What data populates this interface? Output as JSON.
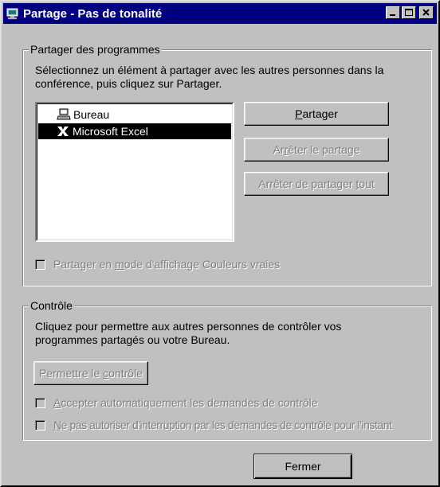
{
  "window": {
    "title": "Partage - Pas de tonalité",
    "icon": "netmeeting-sharing-icon"
  },
  "share_group": {
    "legend": "Partager des programmes",
    "description": "Sélectionnez un élément à partager avec les autres personnes dans la conférence, puis cliquez sur Partager.",
    "items": [
      {
        "label": "Bureau",
        "icon": "desktop-icon",
        "selected": false
      },
      {
        "label": "Microsoft Excel",
        "icon": "excel-icon",
        "selected": true
      }
    ],
    "share_button": {
      "pre": "",
      "mnemonic": "P",
      "post": "artager",
      "enabled": true
    },
    "stop_button": {
      "pre": "Ar",
      "mnemonic": "r",
      "post": "êter le partage",
      "enabled": false
    },
    "stop_all_button": {
      "pre": "Arrêter de partager ",
      "mnemonic": "t",
      "post": "out",
      "enabled": false
    },
    "true_color_checkbox": {
      "pre": "Partager en ",
      "mnemonic": "m",
      "post": "ode d'affichage Couleurs vraies",
      "checked": false,
      "enabled": false
    }
  },
  "control_group": {
    "legend": "Contrôle",
    "description": "Cliquez pour permettre aux autres personnes de contrôler vos programmes partagés ou votre Bureau.",
    "allow_button": {
      "pre": "Permettre le ",
      "mnemonic": "c",
      "post": "ontrôle",
      "enabled": false
    },
    "auto_accept_checkbox": {
      "pre": "",
      "mnemonic": "A",
      "post": "ccepter automatiquement les demandes de contrôle",
      "checked": false,
      "enabled": false
    },
    "no_interrupt_checkbox": {
      "pre": "",
      "mnemonic": "N",
      "post": "e pas autoriser d'interruption par les demandes de contrôle pour l'instant",
      "checked": false,
      "enabled": false
    }
  },
  "close_button": {
    "label": "Fermer"
  },
  "colors": {
    "titlebar": "#000080",
    "face": "#c0c0c0",
    "selection": "#000000",
    "disabled_text": "#808080"
  }
}
